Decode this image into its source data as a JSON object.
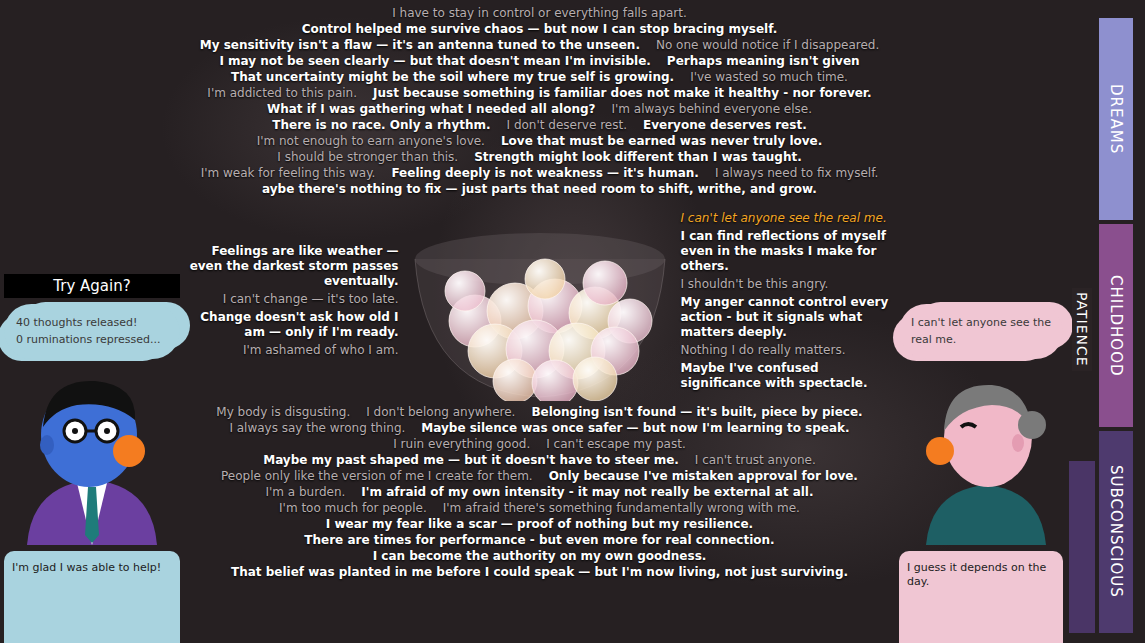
{
  "try_again": {
    "label": "Try Again?"
  },
  "stats": {
    "released": "40 thoughts released!",
    "repressed": "0 ruminations repressed..."
  },
  "left_character": {
    "speech": "I'm glad I was able to help!"
  },
  "right_character": {
    "thought": "I can't let anyone see the real me.",
    "speech": "I guess it depends on the day."
  },
  "patience": {
    "label": "PATIENCE"
  },
  "tabs": [
    {
      "label": "DREAMS",
      "selected": false,
      "color": "#8e90cf"
    },
    {
      "label": "CHILDHOOD",
      "selected": false,
      "color": "#8a4f8e"
    },
    {
      "label": "SUBCONSCIOUS",
      "selected": false,
      "color": "#4e3a6e"
    }
  ],
  "thoughts": [
    {
      "text": "I have to stay in control or everything falls apart.",
      "kind": "negative"
    },
    {
      "text": "Control helped me survive chaos — but now I can stop bracing myself.",
      "kind": "positive"
    },
    {
      "text": "My sensitivity isn't a flaw — it's an antenna tuned to the unseen.",
      "kind": "positive"
    },
    {
      "text": "No one would notice if I disappeared.",
      "kind": "negative"
    },
    {
      "text": "I may not be seen clearly — but that doesn't mean I'm invisible.",
      "kind": "positive"
    },
    {
      "text": "Perhaps meaning isn't given",
      "kind": "positive"
    },
    {
      "text": "That uncertainty might be the soil where my true self is growing.",
      "kind": "positive"
    },
    {
      "text": "I've wasted so much time.",
      "kind": "negative"
    },
    {
      "text": "I'm addicted to this pain.",
      "kind": "negative"
    },
    {
      "text": "Just because something is familiar does not make it healthy - nor forever.",
      "kind": "positive"
    },
    {
      "text": "What if I was gathering what I needed all along?",
      "kind": "positive"
    },
    {
      "text": "I'm always behind everyone else.",
      "kind": "negative"
    },
    {
      "text": "There is no race. Only a rhythm.",
      "kind": "positive"
    },
    {
      "text": "I don't deserve rest.",
      "kind": "negative"
    },
    {
      "text": "Everyone deserves rest.",
      "kind": "positive"
    },
    {
      "text": "I'm not enough to earn anyone's love.",
      "kind": "negative"
    },
    {
      "text": "Love that must be earned was never truly love.",
      "kind": "positive"
    },
    {
      "text": "I should be stronger than this.",
      "kind": "negative"
    },
    {
      "text": "Strength might look different than I was taught.",
      "kind": "positive"
    },
    {
      "text": "I'm weak for feeling this way.",
      "kind": "negative"
    },
    {
      "text": "Feeling deeply is not weakness — it's human.",
      "kind": "positive"
    },
    {
      "text": "I always need to fix myself.",
      "kind": "negative"
    },
    {
      "text": "aybe there's nothing to fix — just parts that need room to shift, writhe, and grow.",
      "kind": "positive"
    },
    {
      "text": "Feelings are like weather — even the darkest storm passes eventually.",
      "kind": "positive"
    },
    {
      "text": "I can't change — it's too late.",
      "kind": "negative"
    },
    {
      "text": "Change doesn't ask how old I am — only if I'm ready.",
      "kind": "positive"
    },
    {
      "text": "I'm ashamed of who I am.",
      "kind": "negative"
    },
    {
      "text": "I can't let anyone see the real me.",
      "kind": "highlight"
    },
    {
      "text": "I can find reflections of myself even in the masks I make for others.",
      "kind": "positive"
    },
    {
      "text": "I shouldn't be this angry.",
      "kind": "negative"
    },
    {
      "text": "My anger cannot control every action - but it signals what matters deeply.",
      "kind": "positive"
    },
    {
      "text": "Nothing I do really matters.",
      "kind": "negative"
    },
    {
      "text": "Maybe I've confused significance with spectacle.",
      "kind": "positive"
    },
    {
      "text": "My body is disgusting.",
      "kind": "negative"
    },
    {
      "text": "I don't belong anywhere.",
      "kind": "negative"
    },
    {
      "text": "Belonging isn't found — it's built, piece by piece.",
      "kind": "positive"
    },
    {
      "text": "I always say the wrong thing.",
      "kind": "negative"
    },
    {
      "text": "Maybe silence was once safer — but now I'm learning to speak.",
      "kind": "positive"
    },
    {
      "text": "I ruin everything good.",
      "kind": "negative"
    },
    {
      "text": "I can't escape my past.",
      "kind": "negative"
    },
    {
      "text": "Maybe my past shaped me — but it doesn't have to steer me.",
      "kind": "positive"
    },
    {
      "text": "I can't trust anyone.",
      "kind": "negative"
    },
    {
      "text": "People only like the version of me I create for them.",
      "kind": "negative"
    },
    {
      "text": "Only because I've mistaken approval for love.",
      "kind": "positive"
    },
    {
      "text": "I'm a burden.",
      "kind": "negative"
    },
    {
      "text": "I'm afraid of my own intensity - it may not really be external at all.",
      "kind": "positive"
    },
    {
      "text": "I'm too much for people.",
      "kind": "negative"
    },
    {
      "text": "I'm afraid there's something fundamentally wrong with me.",
      "kind": "negative"
    },
    {
      "text": "I wear my fear like a scar — proof of nothing but my resilience.",
      "kind": "positive"
    },
    {
      "text": "There are times for performance - but even more for real connection.",
      "kind": "positive"
    },
    {
      "text": "I can become the authority on my own goodness.",
      "kind": "positive"
    },
    {
      "text": "That belief was planted in me before I could speak — but I'm now living, not just surviving.",
      "kind": "positive"
    }
  ]
}
